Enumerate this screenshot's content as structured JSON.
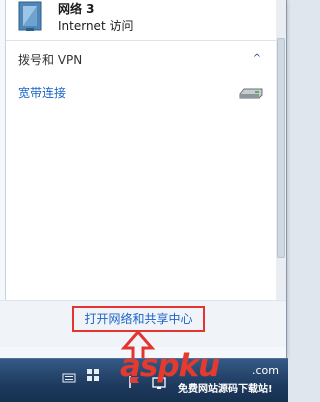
{
  "network": {
    "name": "网络  3",
    "status": "Internet 访问",
    "icon": "network-connected-icon"
  },
  "dialup_section": {
    "title": "拨号和 VPN",
    "chevron": "^",
    "items": [
      {
        "label": "宽带连接",
        "icon": "modem-icon"
      }
    ]
  },
  "footer": {
    "open_center_link": "打开网络和共享中心"
  },
  "watermark": {
    "brand": "aspku",
    "tld": ".com",
    "tagline": "免费网站源码下载站!"
  },
  "colors": {
    "link": "#1a64c9",
    "highlight_box": "#e43432",
    "taskbar": "#1e3a5f"
  }
}
